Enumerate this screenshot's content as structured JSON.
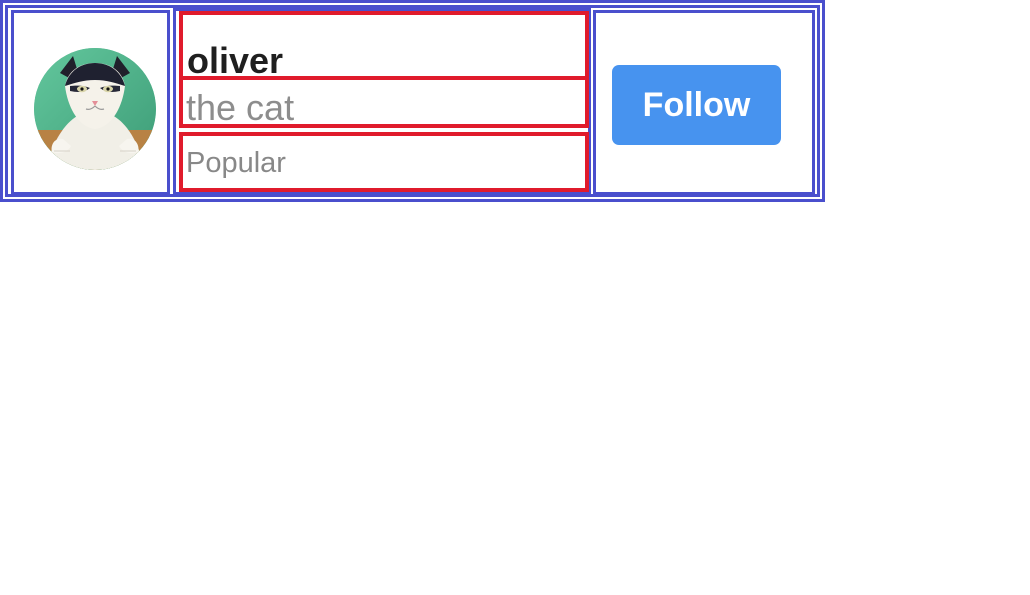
{
  "profile": {
    "name": "oliver",
    "subtitle": "the cat",
    "badge": "Popular",
    "avatar_icon": "cat-photo-icon",
    "follow_label": "Follow"
  },
  "colors": {
    "outer_border": "#4a4fcd",
    "info_border": "#e01b2c",
    "follow_button": "#4793ef",
    "name_text": "#1f1f1f",
    "secondary_text": "#8d8d8d"
  }
}
